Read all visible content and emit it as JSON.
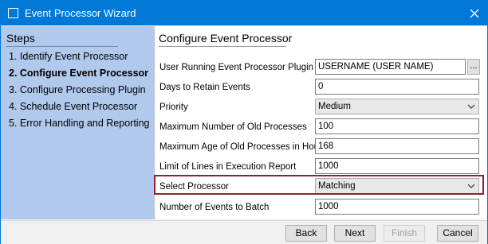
{
  "window": {
    "title": "Event Processor Wizard"
  },
  "steps": {
    "title": "Steps",
    "items": [
      {
        "label": "1. Identify Event Processor",
        "active": false
      },
      {
        "label": "2. Configure Event Processor",
        "active": true
      },
      {
        "label": "3. Configure Processing Plugin",
        "active": false
      },
      {
        "label": "4. Schedule Event Processor",
        "active": false
      },
      {
        "label": "5. Error Handling and Reporting",
        "active": false
      }
    ]
  },
  "form": {
    "title": "Configure Event Processor",
    "user_plugin": {
      "label": "User Running Event Processor Plugin",
      "value": "USERNAME (USER NAME)",
      "browse_label": "..."
    },
    "days_retain": {
      "label": "Days to Retain Events",
      "value": "0"
    },
    "priority": {
      "label": "Priority",
      "value": "Medium"
    },
    "max_old_processes": {
      "label": "Maximum Number of Old Processes",
      "value": "100"
    },
    "max_age_hours": {
      "label": "Maximum Age of Old Processes in Hours",
      "value": "168"
    },
    "limit_lines": {
      "label": "Limit of Lines in Execution Report",
      "value": "1000"
    },
    "select_processor": {
      "label": "Select Processor",
      "value": "Matching"
    },
    "events_to_batch": {
      "label": "Number of Events to Batch",
      "value": "1000"
    }
  },
  "footer": {
    "back_label": "Back",
    "next_label": "Next",
    "finish_label": "Finish",
    "cancel_label": "Cancel"
  },
  "colors": {
    "titlebar": "#0078d7",
    "steps_panel": "#b0c9ec",
    "highlight": "#8b2131"
  }
}
